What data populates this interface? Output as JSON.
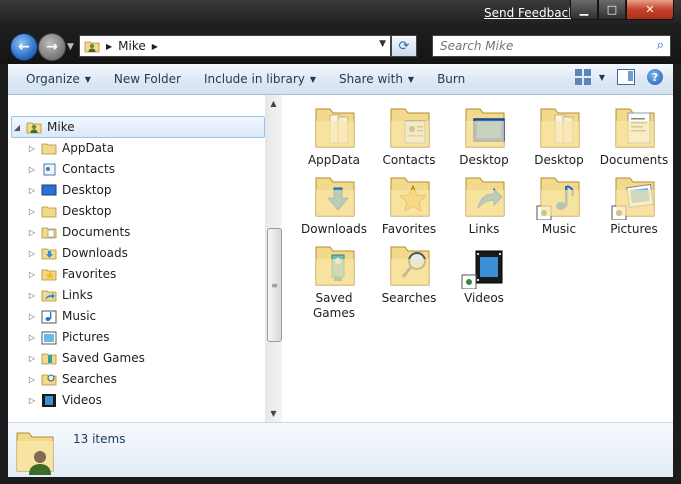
{
  "titlebar": {
    "feedback": "Send Feedback"
  },
  "address": {
    "location": "Mike"
  },
  "search": {
    "placeholder": "Search Mike"
  },
  "toolbar": {
    "organize": "Organize",
    "new_folder": "New Folder",
    "include": "Include in library",
    "share": "Share with",
    "burn": "Burn"
  },
  "nav": {
    "root": "Mike",
    "items": [
      {
        "label": "AppData",
        "icon": "folder-icon"
      },
      {
        "label": "Contacts",
        "icon": "contacts-icon"
      },
      {
        "label": "Desktop",
        "icon": "desktop-icon"
      },
      {
        "label": "Desktop",
        "icon": "folder-icon"
      },
      {
        "label": "Documents",
        "icon": "documents-icon"
      },
      {
        "label": "Downloads",
        "icon": "downloads-icon"
      },
      {
        "label": "Favorites",
        "icon": "favorites-icon"
      },
      {
        "label": "Links",
        "icon": "links-icon"
      },
      {
        "label": "Music",
        "icon": "music-icon"
      },
      {
        "label": "Pictures",
        "icon": "pictures-icon"
      },
      {
        "label": "Saved Games",
        "icon": "saved-games-icon"
      },
      {
        "label": "Searches",
        "icon": "searches-icon"
      },
      {
        "label": "Videos",
        "icon": "videos-icon"
      }
    ]
  },
  "files": [
    {
      "label": "AppData",
      "icon": "folder-icon"
    },
    {
      "label": "Contacts",
      "icon": "contacts-icon"
    },
    {
      "label": "Desktop",
      "icon": "desktop-icon"
    },
    {
      "label": "Desktop",
      "icon": "folder-icon"
    },
    {
      "label": "Documents",
      "icon": "documents-icon"
    },
    {
      "label": "Downloads",
      "icon": "downloads-icon"
    },
    {
      "label": "Favorites",
      "icon": "favorites-icon"
    },
    {
      "label": "Links",
      "icon": "links-icon"
    },
    {
      "label": "Music",
      "icon": "music-icon"
    },
    {
      "label": "Pictures",
      "icon": "pictures-icon"
    },
    {
      "label": "Saved Games",
      "icon": "saved-games-icon"
    },
    {
      "label": "Searches",
      "icon": "searches-icon"
    },
    {
      "label": "Videos",
      "icon": "videos-icon"
    }
  ],
  "details": {
    "count": "13 items"
  },
  "colors": {
    "folder": "#f3d98b",
    "selection": "#dbe9fa",
    "accent": "#1e395b"
  }
}
